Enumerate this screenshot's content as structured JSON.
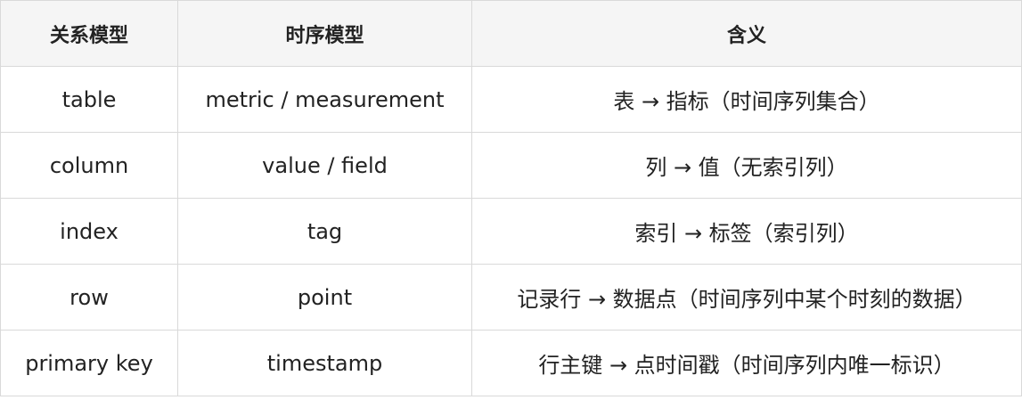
{
  "table": {
    "headers": [
      "关系模型",
      "时序模型",
      "含义"
    ],
    "rows": [
      [
        "table",
        "metric / measurement",
        "表 → 指标（时间序列集合）"
      ],
      [
        "column",
        "value / field",
        "列 → 值（无索引列）"
      ],
      [
        "index",
        "tag",
        "索引 → 标签（索引列）"
      ],
      [
        "row",
        "point",
        "记录行 → 数据点（时间序列中某个时刻的数据）"
      ],
      [
        "primary key",
        "timestamp",
        "行主键 → 点时间戳（时间序列内唯一标识）"
      ]
    ]
  }
}
